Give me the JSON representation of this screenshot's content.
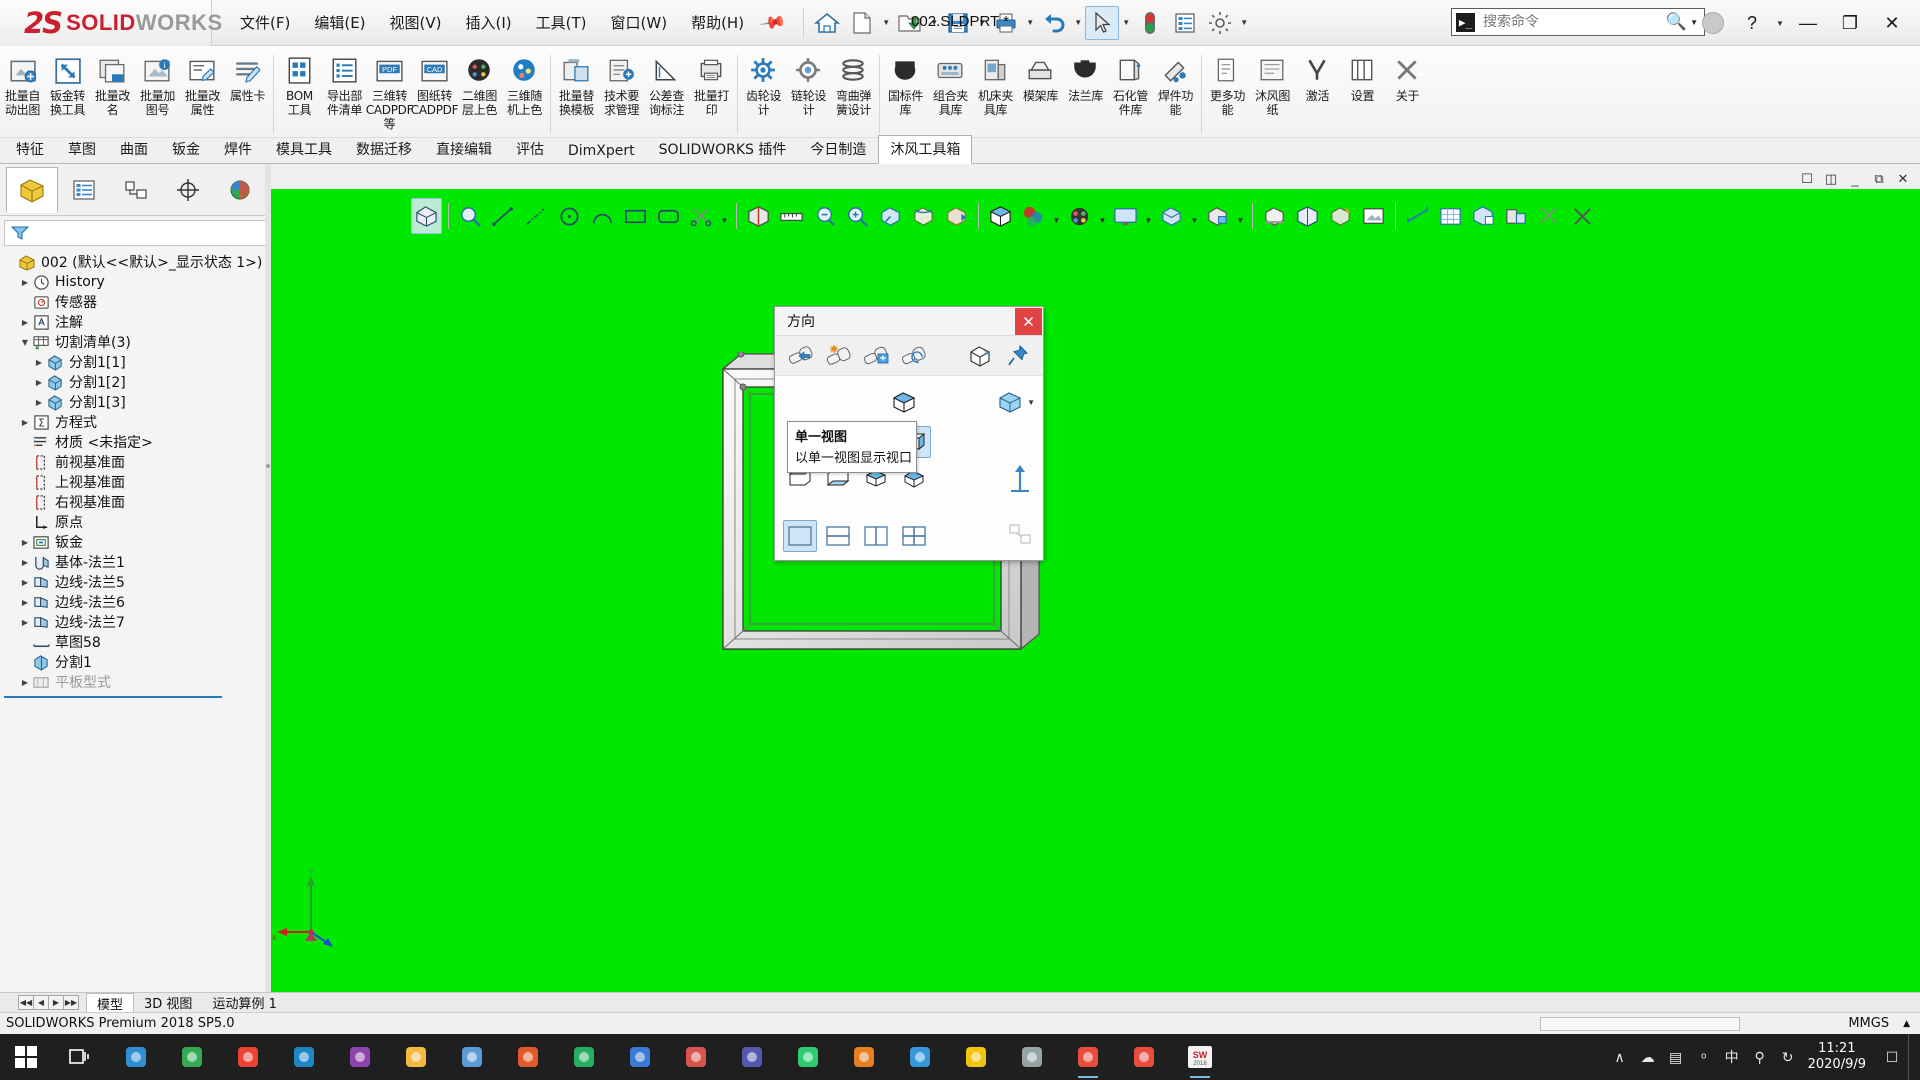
{
  "app": {
    "brand_mark": "2S",
    "brand_word1": "SOLID",
    "brand_word2": "WORKS",
    "document_title": "002.SLDPRT *",
    "status_text": "SOLIDWORKS Premium 2018 SP5.0",
    "units": "MMGS"
  },
  "menubar": {
    "items": [
      {
        "label": "文件(F)",
        "name": "menu-file"
      },
      {
        "label": "编辑(E)",
        "name": "menu-edit"
      },
      {
        "label": "视图(V)",
        "name": "menu-view"
      },
      {
        "label": "插入(I)",
        "name": "menu-insert"
      },
      {
        "label": "工具(T)",
        "name": "menu-tools"
      },
      {
        "label": "窗口(W)",
        "name": "menu-window"
      },
      {
        "label": "帮助(H)",
        "name": "menu-help"
      }
    ]
  },
  "quickaccess": {
    "items": [
      {
        "name": "home-icon",
        "glyph": "home"
      },
      {
        "name": "new-document-icon",
        "glyph": "page"
      },
      {
        "name": "open-folder-icon",
        "glyph": "open"
      },
      {
        "name": "save-icon",
        "glyph": "save"
      },
      {
        "name": "print-icon",
        "glyph": "print"
      },
      {
        "name": "undo-icon",
        "glyph": "undo"
      },
      {
        "name": "select-cursor-icon",
        "glyph": "cursor"
      },
      {
        "name": "rebuild-traffic-light-icon",
        "glyph": "traffic"
      },
      {
        "name": "file-properties-icon",
        "glyph": "props"
      },
      {
        "name": "options-gear-icon",
        "glyph": "gear"
      }
    ]
  },
  "search": {
    "placeholder": "搜索命令",
    "value": ""
  },
  "window_controls": {
    "help_label": "?",
    "minimize_label": "—",
    "restore_label": "❐",
    "close_label": "✕"
  },
  "ribbon": {
    "groups": [
      {
        "name": "group-batch-tools",
        "buttons": [
          {
            "name": "batch-auto-drawing",
            "label": "批量自\n动出图",
            "icon": "batch-drawing-icon"
          },
          {
            "name": "sheetmetal-convert-tool",
            "label": "钣金转\n换工具",
            "icon": "sheetmetal-convert-icon"
          },
          {
            "name": "batch-rename",
            "label": "批量改\n名",
            "icon": "batch-rename-icon"
          },
          {
            "name": "batch-add-number",
            "label": "批量加\n图号",
            "icon": "batch-number-icon"
          },
          {
            "name": "batch-edit-properties",
            "label": "批量改\n属性",
            "icon": "batch-props-icon"
          },
          {
            "name": "property-card",
            "label": "属性卡",
            "icon": "property-card-icon"
          }
        ]
      },
      {
        "name": "group-export",
        "buttons": [
          {
            "name": "bom-tool",
            "label": "BOM\n工具",
            "icon": "bom-icon"
          },
          {
            "name": "export-parts-list",
            "label": "导出部\n件清单",
            "icon": "export-list-icon"
          },
          {
            "name": "threed-to-cadpdf",
            "label": "三维转\nCADPDF\n等",
            "icon": "3d-cadpdf-icon"
          },
          {
            "name": "drawing-to-cadpdf",
            "label": "图纸转\nCADPDF",
            "icon": "drawing-cadpdf-icon"
          },
          {
            "name": "twod-layer-color",
            "label": "二维图\n层上色",
            "icon": "2d-layer-color-icon"
          },
          {
            "name": "threed-machine-color",
            "label": "三维随\n机上色",
            "icon": "3d-random-color-icon"
          }
        ]
      },
      {
        "name": "group-templates",
        "buttons": [
          {
            "name": "batch-replace-template",
            "label": "批量替\n换模板",
            "icon": "replace-template-icon"
          },
          {
            "name": "tech-requirements",
            "label": "技术要\n求管理",
            "icon": "tech-req-icon"
          },
          {
            "name": "tolerance-query",
            "label": "公差查\n询标注",
            "icon": "tolerance-icon"
          },
          {
            "name": "batch-print",
            "label": "批量打\n印",
            "icon": "batch-print-icon"
          }
        ]
      },
      {
        "name": "group-design",
        "buttons": [
          {
            "name": "gear-design",
            "label": "齿轮设\n计",
            "icon": "gear-design-icon"
          },
          {
            "name": "sprocket-design",
            "label": "链轮设\n计",
            "icon": "sprocket-design-icon"
          },
          {
            "name": "spring-design",
            "label": "弯曲弹\n簧设计",
            "icon": "spring-design-icon"
          }
        ]
      },
      {
        "name": "group-libraries",
        "buttons": [
          {
            "name": "national-standard-library",
            "label": "国标件\n库",
            "icon": "gb-library-icon"
          },
          {
            "name": "fixture-library",
            "label": "组合夹\n具库",
            "icon": "fixture-icon"
          },
          {
            "name": "machine-fixture-library",
            "label": "机床夹\n具库",
            "icon": "machine-fixture-icon"
          },
          {
            "name": "mold-base-library",
            "label": "模架库",
            "icon": "mold-base-icon"
          },
          {
            "name": "flange-library",
            "label": "法兰库",
            "icon": "flange-icon"
          },
          {
            "name": "petrochemical-pipe-library",
            "label": "石化管\n件库",
            "icon": "pipe-icon"
          },
          {
            "name": "weldment-function",
            "label": "焊件功\n能",
            "icon": "weldment-icon"
          }
        ]
      },
      {
        "name": "group-misc",
        "buttons": [
          {
            "name": "more-functions",
            "label": "更多功\n能",
            "icon": "more-functions-icon"
          },
          {
            "name": "mufeng-drawing",
            "label": "沐风图\n纸",
            "icon": "mufeng-drawing-icon"
          },
          {
            "name": "activate",
            "label": "激活",
            "icon": "activate-icon"
          },
          {
            "name": "settings",
            "label": "设置",
            "icon": "settings-icon"
          },
          {
            "name": "about",
            "label": "关于",
            "icon": "about-icon"
          }
        ]
      }
    ]
  },
  "command_tabs": {
    "active": "沐风工具箱",
    "items": [
      {
        "label": "特征",
        "name": "tab-features"
      },
      {
        "label": "草图",
        "name": "tab-sketch"
      },
      {
        "label": "曲面",
        "name": "tab-surfaces"
      },
      {
        "label": "钣金",
        "name": "tab-sheetmetal"
      },
      {
        "label": "焊件",
        "name": "tab-weldments"
      },
      {
        "label": "模具工具",
        "name": "tab-mold-tools"
      },
      {
        "label": "数据迁移",
        "name": "tab-data-migration"
      },
      {
        "label": "直接编辑",
        "name": "tab-direct-edit"
      },
      {
        "label": "评估",
        "name": "tab-evaluate"
      },
      {
        "label": "DimXpert",
        "name": "tab-dimxpert"
      },
      {
        "label": "SOLIDWORKS 插件",
        "name": "tab-sw-addins"
      },
      {
        "label": "今日制造",
        "name": "tab-today-manufacturing"
      },
      {
        "label": "沐风工具箱",
        "name": "tab-mufeng-toolbox"
      }
    ]
  },
  "manager_tabs": [
    {
      "name": "feature-manager-tab",
      "icon": "feature-tree-icon",
      "active": true
    },
    {
      "name": "property-manager-tab",
      "icon": "property-list-icon",
      "active": false
    },
    {
      "name": "configuration-manager-tab",
      "icon": "configuration-icon",
      "active": false
    },
    {
      "name": "dimxpert-manager-tab",
      "icon": "dimxpert-target-icon",
      "active": false
    },
    {
      "name": "display-manager-tab",
      "icon": "display-sphere-icon",
      "active": false
    }
  ],
  "filter": {
    "placeholder": "",
    "icon": "filter-funnel-icon"
  },
  "tree": {
    "root": "002  (默认<<默认>_显示状态 1>)",
    "items": [
      {
        "label": "History",
        "indent": 1,
        "arrow": true,
        "icon": "history-icon",
        "dim": false
      },
      {
        "label": "传感器",
        "indent": 1,
        "arrow": false,
        "icon": "sensors-icon",
        "dim": false
      },
      {
        "label": "注解",
        "indent": 1,
        "arrow": true,
        "icon": "annotations-icon",
        "dim": false
      },
      {
        "label": "切割清单(3)",
        "indent": 1,
        "arrow": true,
        "expanded": true,
        "icon": "cutlist-icon",
        "dim": false
      },
      {
        "label": "分割1[1]",
        "indent": 2,
        "arrow": true,
        "icon": "solid-body-icon",
        "dim": false
      },
      {
        "label": "分割1[2]",
        "indent": 2,
        "arrow": true,
        "icon": "solid-body-icon",
        "dim": false
      },
      {
        "label": "分割1[3]",
        "indent": 2,
        "arrow": true,
        "icon": "solid-body-icon",
        "dim": false
      },
      {
        "label": "方程式",
        "indent": 1,
        "arrow": true,
        "icon": "equations-icon",
        "dim": false
      },
      {
        "label": "材质 <未指定>",
        "indent": 1,
        "arrow": false,
        "icon": "material-icon",
        "dim": false
      },
      {
        "label": "前视基准面",
        "indent": 1,
        "arrow": false,
        "icon": "plane-icon",
        "dim": false
      },
      {
        "label": "上视基准面",
        "indent": 1,
        "arrow": false,
        "icon": "plane-icon",
        "dim": false
      },
      {
        "label": "右视基准面",
        "indent": 1,
        "arrow": false,
        "icon": "plane-icon",
        "dim": false
      },
      {
        "label": "原点",
        "indent": 1,
        "arrow": false,
        "icon": "origin-icon",
        "dim": false
      },
      {
        "label": "钣金",
        "indent": 1,
        "arrow": true,
        "icon": "sheetmetal-folder-icon",
        "dim": false
      },
      {
        "label": "基体-法兰1",
        "indent": 1,
        "arrow": true,
        "icon": "base-flange-icon",
        "dim": false
      },
      {
        "label": "边线-法兰5",
        "indent": 1,
        "arrow": true,
        "icon": "edge-flange-icon",
        "dim": false
      },
      {
        "label": "边线-法兰6",
        "indent": 1,
        "arrow": true,
        "icon": "edge-flange-icon",
        "dim": false
      },
      {
        "label": "边线-法兰7",
        "indent": 1,
        "arrow": true,
        "icon": "edge-flange-icon",
        "dim": false
      },
      {
        "label": "草图58",
        "indent": 1,
        "arrow": false,
        "icon": "sketch-icon",
        "dim": false
      },
      {
        "label": "分割1",
        "indent": 1,
        "arrow": false,
        "icon": "split-icon",
        "dim": false
      },
      {
        "label": "平板型式",
        "indent": 1,
        "arrow": true,
        "icon": "flat-pattern-icon",
        "dim": true
      }
    ]
  },
  "view_toolbar": {
    "buttons": [
      {
        "name": "zoom-to-fit-icon",
        "sel": true
      },
      {
        "name": "zoom-to-area-icon"
      },
      {
        "name": "line-icon"
      },
      {
        "name": "centerline-icon"
      },
      {
        "name": "circle-icon"
      },
      {
        "name": "arc-icon"
      },
      {
        "name": "rectangle-icon"
      },
      {
        "name": "rounded-rectangle-icon"
      },
      {
        "name": "trim-entities-icon",
        "caret": true
      },
      {
        "name": "section-view-icon"
      },
      {
        "name": "measure-icon"
      },
      {
        "name": "mass-properties-icon"
      },
      {
        "name": "zoom-in-out-icon"
      },
      {
        "name": "zoom-to-selection-icon"
      },
      {
        "name": "rotate-view-icon"
      },
      {
        "name": "pan-icon"
      },
      {
        "name": "view-orientation-icon"
      },
      {
        "name": "display-style-icon",
        "caret": true
      },
      {
        "name": "hide-show-items-icon",
        "caret": true
      },
      {
        "name": "edit-appearance-icon",
        "caret": true
      },
      {
        "name": "apply-scene-icon",
        "caret": true
      },
      {
        "name": "view-settings-icon",
        "caret": true
      },
      {
        "name": "shadows-icon"
      },
      {
        "name": "perspective-icon"
      },
      {
        "name": "ambient-occlusion-icon"
      },
      {
        "name": "sketch-picture-icon"
      },
      {
        "name": "dimension-icon"
      },
      {
        "name": "display-grid-icon"
      },
      {
        "name": "component-icon"
      },
      {
        "name": "isolate-icon"
      },
      {
        "name": "cross-hair-icon"
      },
      {
        "name": "close-x-icon"
      }
    ]
  },
  "dialog": {
    "title": "方向",
    "close_label": "✕",
    "row_a": [
      {
        "name": "previous-view-icon"
      },
      {
        "name": "new-view-icon"
      },
      {
        "name": "update-standard-views-icon"
      },
      {
        "name": "reset-standard-views-icon"
      },
      {
        "name": "normal-to-icon"
      },
      {
        "name": "pushpin-icon"
      }
    ],
    "row_b": [
      {
        "name": "isometric-view-icon"
      },
      {
        "name": "view-selector-icon",
        "caret": true
      }
    ],
    "row_c": [
      {
        "name": "front-view-icon"
      },
      {
        "name": "back-view-icon"
      },
      {
        "name": "left-view-icon"
      },
      {
        "name": "right-view-icon",
        "sel": true
      }
    ],
    "row_d": [
      {
        "name": "top-view-icon"
      },
      {
        "name": "bottom-view-icon"
      },
      {
        "name": "trimetric-view-icon"
      },
      {
        "name": "dimetric-view-icon"
      },
      {
        "name": "normal-to-arrow-icon"
      }
    ],
    "row_e": [
      {
        "name": "single-view-icon",
        "sel": true
      },
      {
        "name": "two-view-horizontal-icon"
      },
      {
        "name": "two-view-vertical-icon"
      },
      {
        "name": "four-view-icon"
      },
      {
        "name": "link-views-icon",
        "disabled": true
      }
    ]
  },
  "tooltip": {
    "title": "单一视图",
    "description": "以单一视图显示视口"
  },
  "doc_tabs": {
    "items": [
      {
        "label": "模型",
        "name": "doctab-model",
        "active": true
      },
      {
        "label": "3D 视图",
        "name": "doctab-3dview",
        "active": false
      },
      {
        "label": "运动算例 1",
        "name": "doctab-motion-study",
        "active": false
      }
    ]
  },
  "taskbar": {
    "start_label": "⊞",
    "items": [
      {
        "name": "task-view-icon",
        "color": "#ffffff"
      },
      {
        "name": "edge-icon",
        "color": "#2e8fd4"
      },
      {
        "name": "chrome-icon",
        "color": "#34a853"
      },
      {
        "name": "chrome2-icon",
        "color": "#ea4335"
      },
      {
        "name": "ie-icon",
        "color": "#1e88c7"
      },
      {
        "name": "creative-app-icon",
        "color": "#8e44ad"
      },
      {
        "name": "file-explorer-icon",
        "color": "#f4b942"
      },
      {
        "name": "calculator-icon",
        "color": "#5b9bd5"
      },
      {
        "name": "antivirus-icon",
        "color": "#e05a2b"
      },
      {
        "name": "paint-icon",
        "color": "#27ae60"
      },
      {
        "name": "wps-icon",
        "color": "#3a7bd5"
      },
      {
        "name": "photo-app-icon",
        "color": "#d9534f"
      },
      {
        "name": "teams-icon",
        "color": "#5558af"
      },
      {
        "name": "green-app-icon",
        "color": "#2ecc71"
      },
      {
        "name": "orange-gear-icon",
        "color": "#e67e22"
      },
      {
        "name": "blue-circle-icon",
        "color": "#3498db"
      },
      {
        "name": "cat-app-icon",
        "color": "#f1c40f"
      },
      {
        "name": "camera-icon",
        "color": "#95a5a6"
      },
      {
        "name": "media-player-icon",
        "color": "#e74c3c",
        "running": true
      },
      {
        "name": "x-app-icon",
        "color": "#e74c3c"
      },
      {
        "name": "solidworks-app-icon",
        "color": "#c8202e",
        "running": true
      }
    ],
    "tray": [
      {
        "name": "show-hidden-icons",
        "glyph": "∧"
      },
      {
        "name": "onedrive-icon",
        "glyph": "☁"
      },
      {
        "name": "network-icon",
        "glyph": "▤"
      },
      {
        "name": "volume-icon",
        "glyph": "ᵒ"
      },
      {
        "name": "input-method-icon",
        "glyph": "中"
      },
      {
        "name": "usb-icon",
        "glyph": "⚲"
      },
      {
        "name": "sync-icon",
        "glyph": "↻"
      }
    ],
    "clock_time": "11:21",
    "clock_date": "2020/9/9",
    "show_desktop": ""
  },
  "colors": {
    "viewport_bg": "#00e800",
    "brand_red": "#c8202e",
    "accent_blue": "#2b7ab8",
    "selection_blue": "#cfe4f5"
  }
}
